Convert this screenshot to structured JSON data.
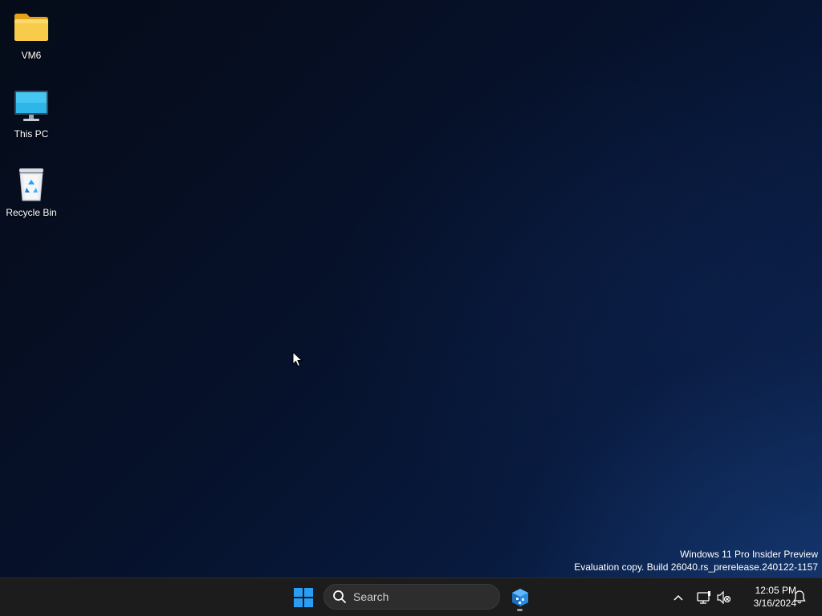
{
  "desktop": {
    "icons": [
      {
        "label": "VM6",
        "icon": "folder-icon"
      },
      {
        "label": "This PC",
        "icon": "monitor-icon"
      },
      {
        "label": "Recycle Bin",
        "icon": "recycle-bin-icon"
      }
    ],
    "watermark": {
      "line1": "Windows 11 Pro Insider Preview",
      "line2": "Evaluation copy. Build 26040.rs_prerelease.240122-1157"
    }
  },
  "taskbar": {
    "start_icon": "windows-logo-icon",
    "search": {
      "placeholder": "Search"
    },
    "pinned_app": {
      "icon": "app-package-icon"
    },
    "tray": {
      "overflow_icon": "chevron-up-icon",
      "network_icon": "network-icon",
      "volume_icon": "volume-muted-icon",
      "notification_icon": "bell-icon"
    },
    "clock": {
      "time": "12:05 PM",
      "date": "3/16/2024"
    }
  },
  "colors": {
    "taskbar_bg": "#1c1c1c",
    "search_bg": "#2d2d2d",
    "windows_blue": "#2a9df4",
    "folder_yellow": "#f8cc4a"
  }
}
